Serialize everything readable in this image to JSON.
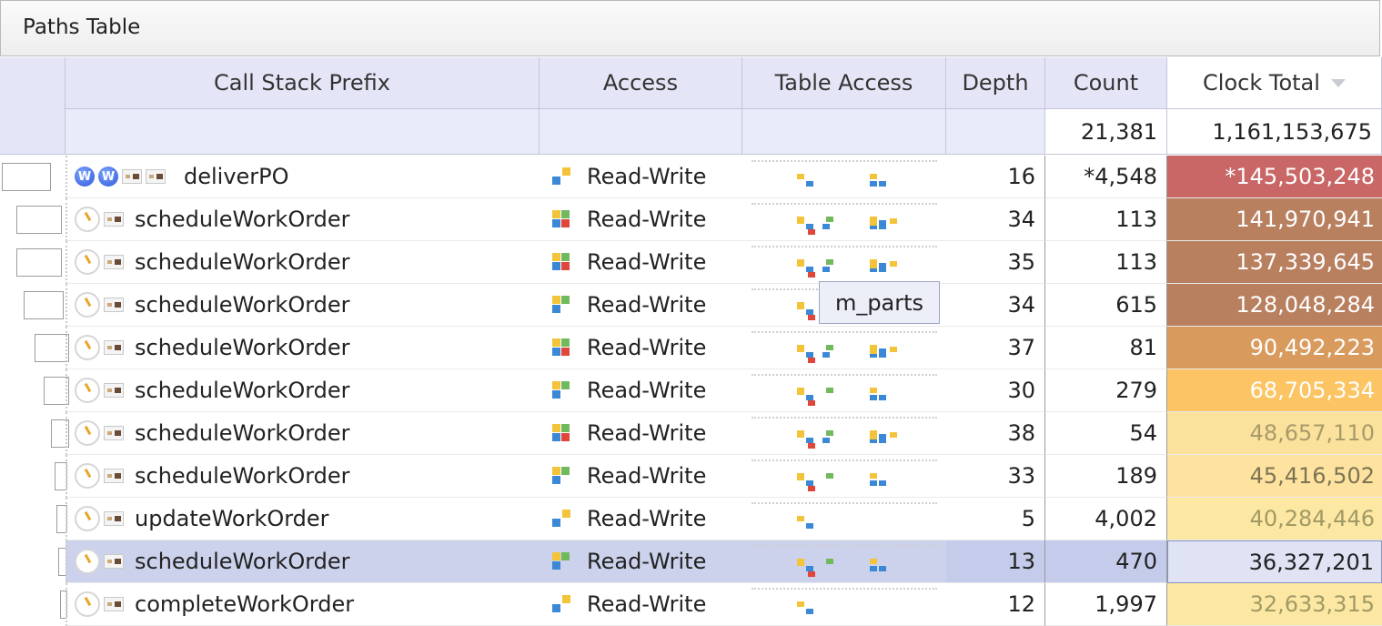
{
  "panel": {
    "title": "Paths Table"
  },
  "columns": {
    "call_stack_prefix": "Call Stack Prefix",
    "access": "Access",
    "table_access": "Table Access",
    "depth": "Depth",
    "count": "Count",
    "clock_total": "Clock Total"
  },
  "totals": {
    "count": "21,381",
    "clock_total": "1,161,153,675"
  },
  "tooltip": {
    "text": "m_parts"
  },
  "colors": {
    "header_bg": "#e4e6f7",
    "selected_row": "#ccd2ec",
    "heat_max": "#c96767",
    "heat_min": "#fde8a3"
  },
  "rows": [
    {
      "name": "deliverPO",
      "access": "Read-Write",
      "depth": "16",
      "count": "*4,548",
      "clock": "*145,503,248",
      "icons": [
        "w-icon",
        "w-icon",
        "method-icon",
        "method-icon"
      ]
    },
    {
      "name": "scheduleWorkOrder",
      "access": "Read-Write",
      "depth": "34",
      "count": "113",
      "clock": "141,970,941",
      "icons": [
        "clock-icon",
        "method-icon"
      ]
    },
    {
      "name": "scheduleWorkOrder",
      "access": "Read-Write",
      "depth": "35",
      "count": "113",
      "clock": "137,339,645",
      "icons": [
        "clock-icon",
        "method-icon"
      ]
    },
    {
      "name": "scheduleWorkOrder",
      "access": "Read-Write",
      "depth": "34",
      "count": "615",
      "clock": "128,048,284",
      "icons": [
        "clock-icon",
        "method-icon"
      ]
    },
    {
      "name": "scheduleWorkOrder",
      "access": "Read-Write",
      "depth": "37",
      "count": "81",
      "clock": "90,492,223",
      "icons": [
        "clock-icon",
        "method-icon"
      ]
    },
    {
      "name": "scheduleWorkOrder",
      "access": "Read-Write",
      "depth": "30",
      "count": "279",
      "clock": "68,705,334",
      "icons": [
        "clock-icon",
        "method-icon"
      ]
    },
    {
      "name": "scheduleWorkOrder",
      "access": "Read-Write",
      "depth": "38",
      "count": "54",
      "clock": "48,657,110",
      "icons": [
        "clock-icon",
        "method-icon"
      ]
    },
    {
      "name": "scheduleWorkOrder",
      "access": "Read-Write",
      "depth": "33",
      "count": "189",
      "clock": "45,416,502",
      "icons": [
        "clock-icon",
        "method-icon"
      ]
    },
    {
      "name": "updateWorkOrder",
      "access": "Read-Write",
      "depth": "5",
      "count": "4,002",
      "clock": "40,284,446",
      "icons": [
        "clock-icon",
        "method-icon"
      ]
    },
    {
      "name": "scheduleWorkOrder",
      "access": "Read-Write",
      "depth": "13",
      "count": "470",
      "clock": "36,327,201",
      "icons": [
        "clock-icon",
        "method-icon"
      ],
      "selected": true
    },
    {
      "name": "completeWorkOrder",
      "access": "Read-Write",
      "depth": "12",
      "count": "1,997",
      "clock": "32,633,315",
      "icons": [
        "clock-icon",
        "method-icon"
      ]
    }
  ]
}
